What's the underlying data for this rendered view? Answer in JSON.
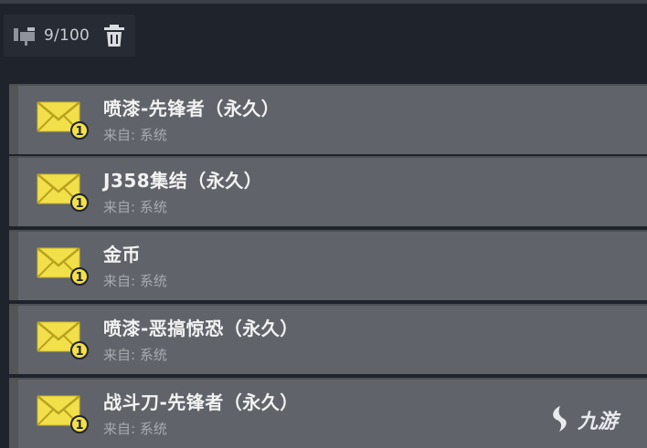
{
  "toolbar": {
    "count_label": "9/100",
    "mailbox_icon": "mailbox-icon",
    "trash_icon": "trash-icon"
  },
  "mail_items": [
    {
      "title": "喷漆-先锋者（永久）",
      "from": "来自: 系统",
      "badge": "1"
    },
    {
      "title": "J358集结（永久）",
      "from": "来自: 系统",
      "badge": "1"
    },
    {
      "title": "金币",
      "from": "来自: 系统",
      "badge": "1"
    },
    {
      "title": "喷漆-恶搞惊恐（永久）",
      "from": "来自: 系统",
      "badge": "1"
    },
    {
      "title": "战斗刀-先锋者（永久）",
      "from": "来自: 系统",
      "badge": "1"
    }
  ],
  "watermark": {
    "text": "九游"
  },
  "colors": {
    "background": "#1f232b",
    "row": "#606369",
    "envelope": "#f2e04a",
    "badge": "#f2e04a"
  }
}
